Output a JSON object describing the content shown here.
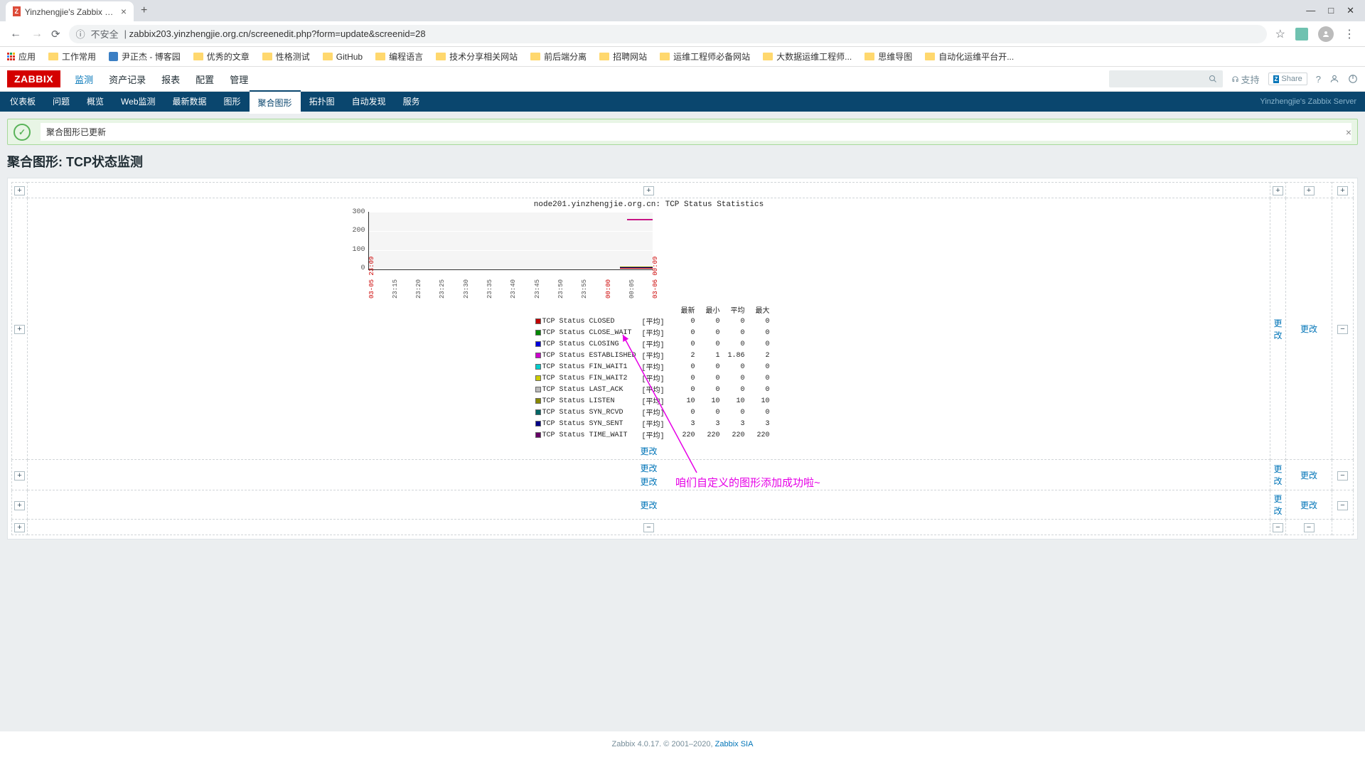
{
  "browser": {
    "tab_title": "Yinzhengjie's Zabbix Server: 聚",
    "url": "zabbix203.yinzhengjie.org.cn/screenedit.php?form=update&screenid=28",
    "insecure_label": "不安全",
    "apps_label": "应用"
  },
  "bookmarks": [
    "工作常用",
    "尹正杰 - 博客园",
    "优秀的文章",
    "性格测试",
    "GitHub",
    "编程语言",
    "技术分享相关网站",
    "前后端分离",
    "招聘网站",
    "运维工程师必备网站",
    "大数据运维工程师...",
    "思维导图",
    "自动化运维平台开..."
  ],
  "zabbix": {
    "logo": "ZABBIX",
    "top_menu": [
      "监测",
      "资产记录",
      "报表",
      "配置",
      "管理"
    ],
    "top_active": "监测",
    "support": "支持",
    "share": "Share",
    "sub_menu": [
      "仪表板",
      "问题",
      "概览",
      "Web监测",
      "最新数据",
      "图形",
      "聚合图形",
      "拓扑图",
      "自动发现",
      "服务"
    ],
    "sub_active": "聚合图形",
    "server_name": "Yinzhengjie's Zabbix Server"
  },
  "alert": {
    "message": "聚合图形已更新"
  },
  "page_title": "聚合图形: TCP状态监测",
  "change_link": "更改",
  "chart_data": {
    "type": "line",
    "title": "node201.yinzhengjie.org.cn: TCP Status Statistics",
    "y_ticks": [
      "300",
      "200",
      "100",
      "0"
    ],
    "x_ticks": [
      "03-05 23:09",
      "23:15",
      "23:20",
      "23:25",
      "23:30",
      "23:35",
      "23:40",
      "23:45",
      "23:50",
      "23:55",
      "00:00",
      "00:05",
      "03-06 00:09"
    ],
    "x_red_indices": [
      0,
      10,
      12
    ],
    "legend_headers": [
      "最新",
      "最小",
      "平均",
      "最大"
    ],
    "avg_label": "[平均]",
    "series": [
      {
        "name": "TCP Status CLOSED",
        "color": "#c00000",
        "last": "0",
        "min": "0",
        "avg": "0",
        "max": "0"
      },
      {
        "name": "TCP Status CLOSE_WAIT",
        "color": "#008800",
        "last": "0",
        "min": "0",
        "avg": "0",
        "max": "0"
      },
      {
        "name": "TCP Status CLOSING",
        "color": "#0000dd",
        "last": "0",
        "min": "0",
        "avg": "0",
        "max": "0"
      },
      {
        "name": "TCP Status ESTABLISHED",
        "color": "#cc00cc",
        "last": "2",
        "min": "1",
        "avg": "1.86",
        "max": "2"
      },
      {
        "name": "TCP Status FIN_WAIT1",
        "color": "#00cccc",
        "last": "0",
        "min": "0",
        "avg": "0",
        "max": "0"
      },
      {
        "name": "TCP Status FIN_WAIT2",
        "color": "#cccc00",
        "last": "0",
        "min": "0",
        "avg": "0",
        "max": "0"
      },
      {
        "name": "TCP Status LAST_ACK",
        "color": "#bbbbbb",
        "last": "0",
        "min": "0",
        "avg": "0",
        "max": "0"
      },
      {
        "name": "TCP Status LISTEN",
        "color": "#888800",
        "last": "10",
        "min": "10",
        "avg": "10",
        "max": "10"
      },
      {
        "name": "TCP Status SYN_RCVD",
        "color": "#006666",
        "last": "0",
        "min": "0",
        "avg": "0",
        "max": "0"
      },
      {
        "name": "TCP Status SYN_SENT",
        "color": "#000088",
        "last": "3",
        "min": "3",
        "avg": "3",
        "max": "3"
      },
      {
        "name": "TCP Status TIME_WAIT",
        "color": "#660066",
        "last": "220",
        "min": "220",
        "avg": "220",
        "max": "220"
      }
    ]
  },
  "annotation": "咱们自定义的图形添加成功啦~",
  "footer": {
    "version": "Zabbix 4.0.17. © 2001–2020, ",
    "link": "Zabbix SIA"
  }
}
